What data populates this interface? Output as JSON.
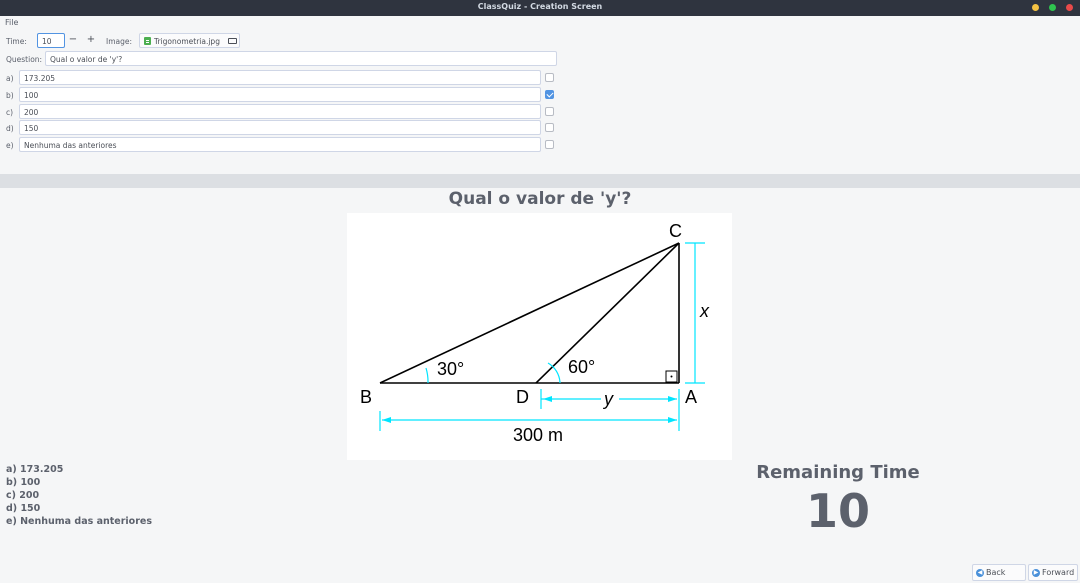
{
  "window": {
    "title": "ClassQuiz - Creation Screen",
    "colors": {
      "close": "#f5c243",
      "minimize": "#2fc44f",
      "maximize": "#e94a4a"
    }
  },
  "menubar": {
    "file": "File"
  },
  "editor": {
    "time_label": "Time:",
    "time_value": "10",
    "minus": "−",
    "plus": "+",
    "image_label": "Image:",
    "image_file": "Trigonometria.jpg",
    "question_label": "Question:",
    "question_value": "Qual o valor de 'y'?",
    "options": [
      {
        "letter": "a)",
        "value": "173.205",
        "checked": false
      },
      {
        "letter": "b)",
        "value": "100",
        "checked": true
      },
      {
        "letter": "c)",
        "value": "200",
        "checked": false
      },
      {
        "letter": "d)",
        "value": "150",
        "checked": false
      },
      {
        "letter": "e)",
        "value": "Nenhuma das anteriores",
        "checked": false
      }
    ]
  },
  "preview": {
    "question": "Qual o valor de 'y'?",
    "figure": {
      "vertices": {
        "A": "A",
        "B": "B",
        "C": "C",
        "D": "D"
      },
      "angle_b": "30°",
      "angle_d": "60°",
      "side_x": "x",
      "side_y": "y",
      "base": "300 m",
      "accent_color": "#00e5ff"
    },
    "answers": [
      "a) 173.205",
      "b) 100",
      "c) 200",
      "d) 150",
      "e) Nenhuma das anteriores"
    ],
    "remaining_label": "Remaining Time",
    "remaining_value": "10"
  },
  "nav": {
    "back": "Back",
    "forward": "Forward"
  }
}
